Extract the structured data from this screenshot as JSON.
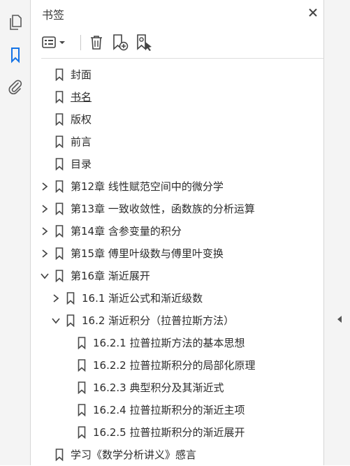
{
  "panel": {
    "title": "书签"
  },
  "left_rail": {
    "icons": [
      "pages-icon",
      "bookmark-icon",
      "attachment-icon"
    ]
  },
  "toolbar": {
    "icons": [
      "options-menu-icon",
      "delete-bookmark-icon",
      "new-bookmark-icon",
      "find-current-bookmark-icon"
    ]
  },
  "bookmarks": [
    {
      "label": "封面",
      "level": 0,
      "expander": "none"
    },
    {
      "label": "书名",
      "level": 0,
      "expander": "none",
      "underline": true
    },
    {
      "label": "版权",
      "level": 0,
      "expander": "none"
    },
    {
      "label": "前言",
      "level": 0,
      "expander": "none"
    },
    {
      "label": "目录",
      "level": 0,
      "expander": "none"
    },
    {
      "label": "第12章  线性赋范空间中的微分学",
      "level": 0,
      "expander": "collapsed"
    },
    {
      "label": "第13章  一致收敛性，函数族的分析运算",
      "level": 0,
      "expander": "collapsed"
    },
    {
      "label": "第14章  含参变量的积分",
      "level": 0,
      "expander": "collapsed"
    },
    {
      "label": "第15章  傅里叶级数与傅里叶变换",
      "level": 0,
      "expander": "collapsed"
    },
    {
      "label": "第16章  渐近展开",
      "level": 0,
      "expander": "expanded"
    },
    {
      "label": "16.1  渐近公式和渐近级数",
      "level": 1,
      "expander": "collapsed"
    },
    {
      "label": "16.2  渐近积分（拉普拉斯方法）",
      "level": 1,
      "expander": "expanded"
    },
    {
      "label": "16.2.1  拉普拉斯方法的基本思想",
      "level": 2,
      "expander": "none"
    },
    {
      "label": "16.2.2  拉普拉斯积分的局部化原理",
      "level": 2,
      "expander": "none"
    },
    {
      "label": "16.2.3  典型积分及其渐近式",
      "level": 2,
      "expander": "none"
    },
    {
      "label": "16.2.4  拉普拉斯积分的渐近主项",
      "level": 2,
      "expander": "none"
    },
    {
      "label": "16.2.5  拉普拉斯积分的渐近展开",
      "level": 2,
      "expander": "none"
    },
    {
      "label": "学习《数学分析讲义》感言",
      "level": 0,
      "expander": "none"
    }
  ],
  "colors": {
    "accent": "#1473e6",
    "icon": "#5a5a5a",
    "rail_bg": "#f4f4f4"
  }
}
